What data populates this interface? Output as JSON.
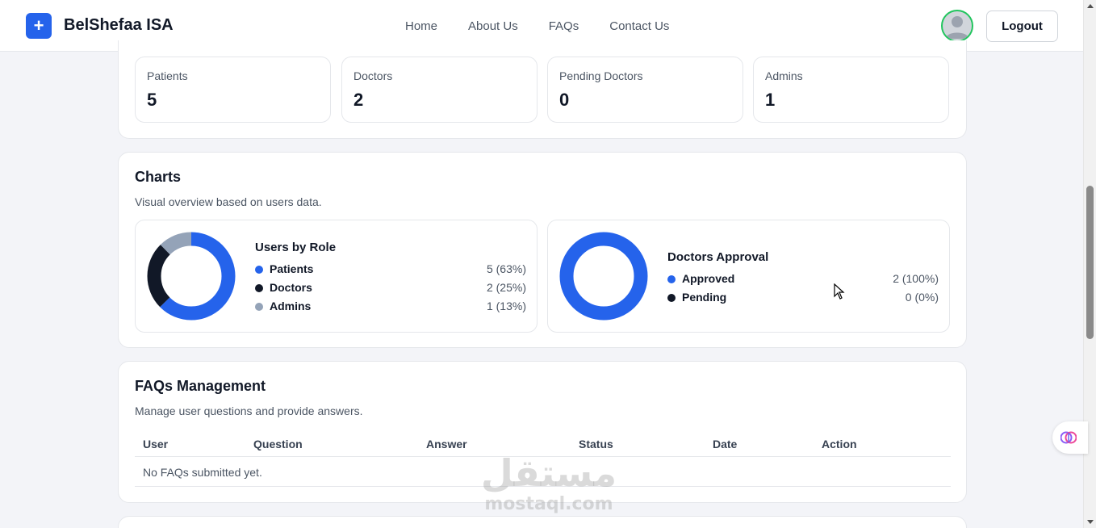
{
  "navbar": {
    "brand_icon": "+",
    "brand_name": "BelShefaa ISA",
    "links": [
      "Home",
      "About Us",
      "FAQs",
      "Contact Us"
    ],
    "logout_label": "Logout"
  },
  "stats": [
    {
      "label": "Patients",
      "value": "5"
    },
    {
      "label": "Doctors",
      "value": "2"
    },
    {
      "label": "Pending Doctors",
      "value": "0"
    },
    {
      "label": "Admins",
      "value": "1"
    }
  ],
  "charts_section": {
    "title": "Charts",
    "subtitle": "Visual overview based on users data."
  },
  "chart_data": [
    {
      "type": "pie",
      "title": "Users by Role",
      "categories": [
        "Patients",
        "Doctors",
        "Admins"
      ],
      "values": [
        5,
        2,
        1
      ],
      "value_labels": [
        "5 (63%)",
        "2 (25%)",
        "1 (13%)"
      ],
      "colors": [
        "#2563eb",
        "#111827",
        "#94a3b8"
      ]
    },
    {
      "type": "pie",
      "title": "Doctors Approval",
      "categories": [
        "Approved",
        "Pending"
      ],
      "values": [
        2,
        0
      ],
      "value_labels": [
        "2 (100%)",
        "0 (0%)"
      ],
      "colors": [
        "#2563eb",
        "#111827"
      ]
    }
  ],
  "faqs_section": {
    "title": "FAQs Management",
    "subtitle": "Manage user questions and provide answers.",
    "columns": [
      "User",
      "Question",
      "Answer",
      "Status",
      "Date",
      "Action"
    ],
    "empty_text": "No FAQs submitted yet."
  },
  "watermark": {
    "arabic": "مستقل",
    "latin": "mostaql.com"
  },
  "colors": {
    "accent": "#2563eb",
    "avatar_ring": "#22c55e"
  }
}
